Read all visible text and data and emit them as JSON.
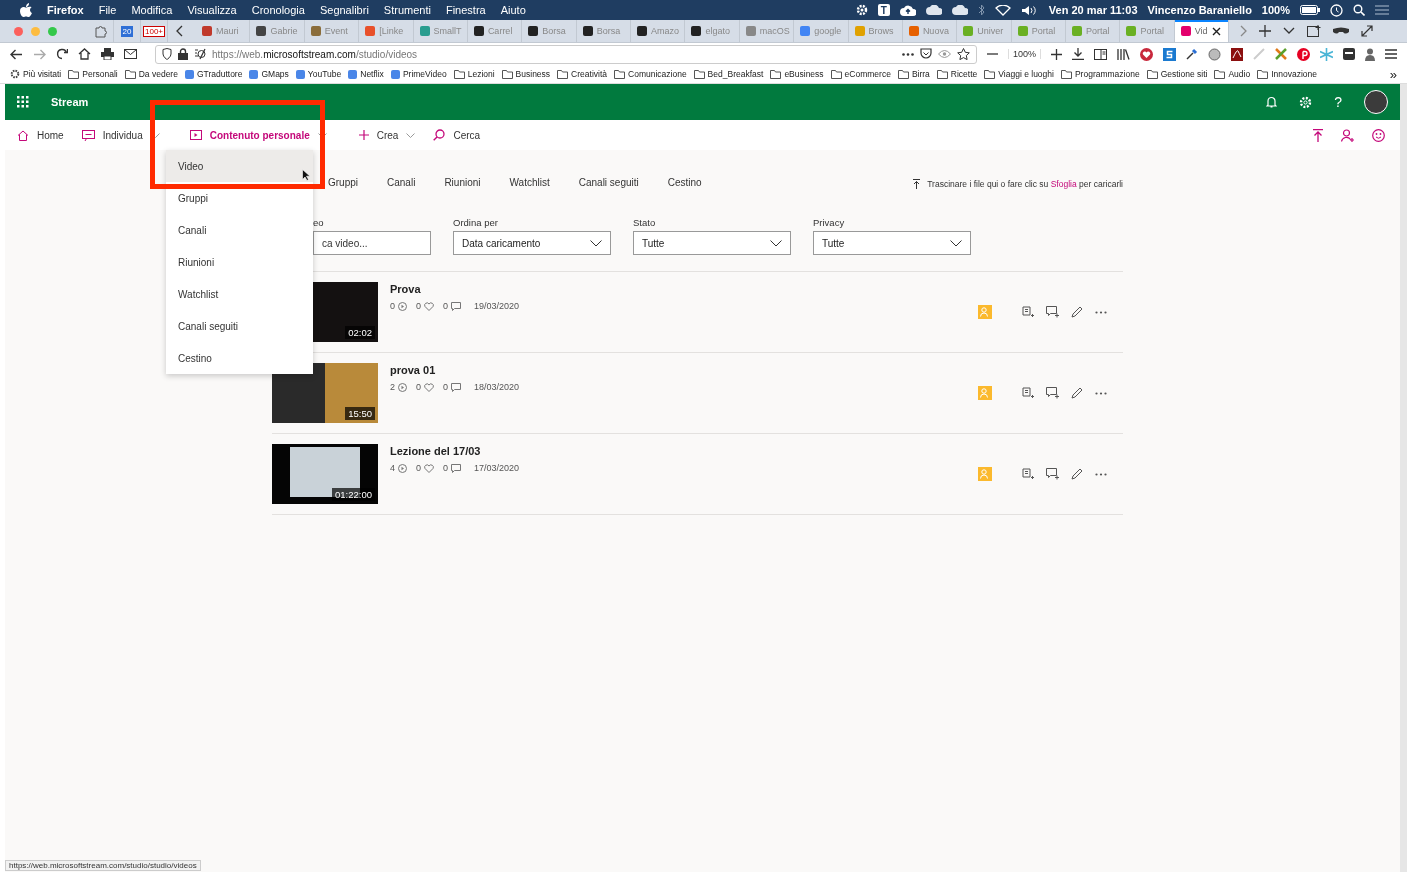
{
  "menubar": {
    "app": "Firefox",
    "menus": [
      "File",
      "Modifica",
      "Visualizza",
      "Cronologia",
      "Segnalibri",
      "Strumenti",
      "Finestra",
      "Aiuto"
    ],
    "tray_letter": "T",
    "clock": "Ven 20 mar  11:03",
    "user": "Vincenzo Baraniello",
    "battery": "100%"
  },
  "pinned_tabs": [
    {
      "kind": "extension"
    },
    {
      "kind": "calendar",
      "text": "20"
    },
    {
      "kind": "mail",
      "text": "100+"
    }
  ],
  "tabs": [
    {
      "title": "Mauri",
      "selected": false
    },
    {
      "title": "Gabrie",
      "selected": false
    },
    {
      "title": "Event",
      "selected": false
    },
    {
      "title": "[Linke",
      "selected": false
    },
    {
      "title": "SmallT",
      "selected": false
    },
    {
      "title": "Carrel",
      "selected": false
    },
    {
      "title": "Borsa",
      "selected": false
    },
    {
      "title": "Borsa",
      "selected": false
    },
    {
      "title": "Amazo",
      "selected": false
    },
    {
      "title": "elgato",
      "selected": false
    },
    {
      "title": "macOS",
      "selected": false
    },
    {
      "title": "google",
      "selected": false
    },
    {
      "title": "Brows",
      "selected": false
    },
    {
      "title": "Nuova",
      "selected": false
    },
    {
      "title": "Univer",
      "selected": false
    },
    {
      "title": "Portal",
      "selected": false
    },
    {
      "title": "Portal",
      "selected": false
    },
    {
      "title": "Portal",
      "selected": false
    },
    {
      "title": "Vid",
      "selected": true
    }
  ],
  "toolbar": {
    "url": "https://web.**microsoftstream.com**/studio/videos",
    "zoom": "100%"
  },
  "bookmarks": {
    "items": [
      {
        "label": "Più visitati",
        "kind": "smart"
      },
      {
        "label": "Personali",
        "kind": "folder"
      },
      {
        "label": "Da vedere",
        "kind": "folder"
      },
      {
        "label": "GTraduttore",
        "kind": "site"
      },
      {
        "label": "GMaps",
        "kind": "site"
      },
      {
        "label": "YouTube",
        "kind": "site"
      },
      {
        "label": "Netflix",
        "kind": "site"
      },
      {
        "label": "PrimeVideo",
        "kind": "site"
      },
      {
        "label": "Lezioni",
        "kind": "folder"
      },
      {
        "label": "Business",
        "kind": "folder"
      },
      {
        "label": "Creatività",
        "kind": "folder"
      },
      {
        "label": "Comunicazione",
        "kind": "folder"
      },
      {
        "label": "Bed_Breakfast",
        "kind": "folder"
      },
      {
        "label": "eBusiness",
        "kind": "folder"
      },
      {
        "label": "eCommerce",
        "kind": "folder"
      },
      {
        "label": "Birra",
        "kind": "folder"
      },
      {
        "label": "Ricette",
        "kind": "folder"
      },
      {
        "label": "Viaggi e luoghi",
        "kind": "folder"
      },
      {
        "label": "Programmazione",
        "kind": "folder"
      },
      {
        "label": "Gestione siti",
        "kind": "folder"
      },
      {
        "label": "Audio",
        "kind": "folder"
      },
      {
        "label": "Innovazione",
        "kind": "folder"
      }
    ],
    "overflow": "»"
  },
  "app": {
    "name": "Stream",
    "help": "?"
  },
  "nav": [
    {
      "label": "Home",
      "selected": false,
      "has_menu": false
    },
    {
      "label": "Individua",
      "selected": false,
      "has_menu": true
    },
    {
      "label": "Contenuto personale",
      "selected": true,
      "has_menu": true
    },
    {
      "label": "Crea",
      "selected": false,
      "has_menu": true
    },
    {
      "label": "Cerca",
      "selected": false,
      "has_menu": false
    }
  ],
  "menu": {
    "items": [
      {
        "label": "Video",
        "selected": true
      },
      {
        "label": "Gruppi",
        "selected": false
      },
      {
        "label": "Canali",
        "selected": false
      },
      {
        "label": "Riunioni",
        "selected": false
      },
      {
        "label": "Watchlist",
        "selected": false
      },
      {
        "label": "Canali seguiti",
        "selected": false
      },
      {
        "label": "Cestino",
        "selected": false
      }
    ]
  },
  "content_tabs": [
    {
      "label": "Gruppi",
      "selected": false
    },
    {
      "label": "Canali",
      "selected": false
    },
    {
      "label": "Riunioni",
      "selected": false
    },
    {
      "label": "Watchlist",
      "selected": false
    },
    {
      "label": "Canali seguiti",
      "selected": false
    },
    {
      "label": "Cestino",
      "selected": false
    }
  ],
  "upload_hint": {
    "before": "Trascinare i file qui o fare clic su",
    "link": "Sfoglia",
    "after": "per caricarli"
  },
  "filters": [
    {
      "kind": "search",
      "label": "eo",
      "placeholder": "ca video..."
    },
    {
      "kind": "select",
      "label": "Ordina per",
      "value": "Data caricamento"
    },
    {
      "kind": "select",
      "label": "Stato",
      "value": "Tutte"
    },
    {
      "kind": "select",
      "label": "Privacy",
      "value": "Tutte"
    }
  ],
  "videos": [
    {
      "title": "Prova",
      "views": "0",
      "likes": "0",
      "comments": "0",
      "date": "19/03/2020",
      "duration": "02:02",
      "kind": "dark"
    },
    {
      "title": "prova 01",
      "views": "2",
      "likes": "0",
      "comments": "0",
      "date": "18/03/2020",
      "duration": "15:50",
      "kind": "camera"
    },
    {
      "title": "Lezione del 17/03",
      "views": "4",
      "likes": "0",
      "comments": "0",
      "date": "17/03/2020",
      "duration": "01:22:00",
      "kind": "screen"
    }
  ],
  "status_url": "https://web.microsoftstream.com/studio/studio/videos"
}
